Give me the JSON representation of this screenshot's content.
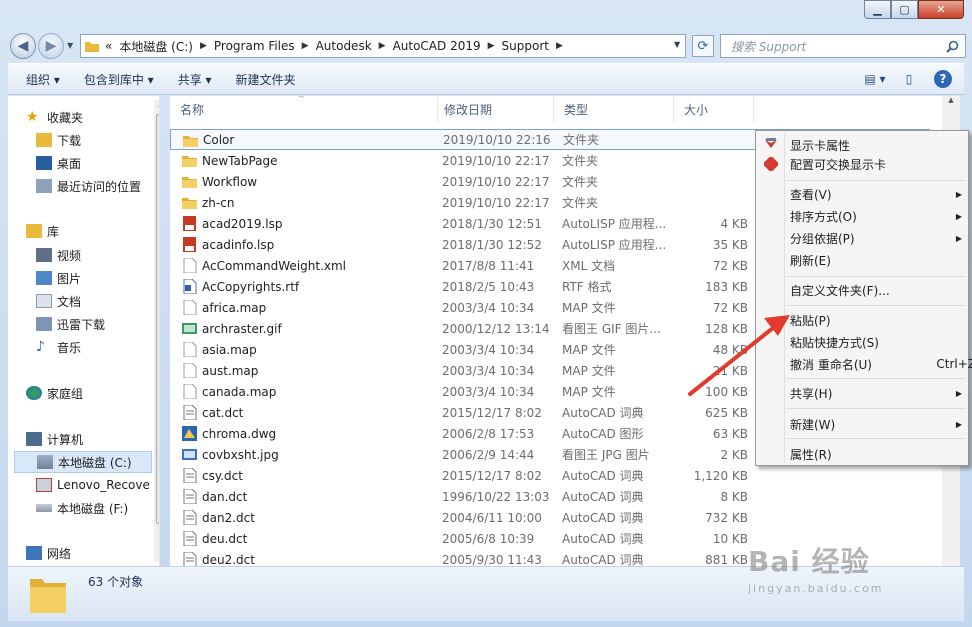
{
  "window": {
    "minimize": "▁",
    "maximize": "▢",
    "close": "✕"
  },
  "address": {
    "prefix": "«",
    "segments": [
      "本地磁盘 (C:)",
      "Program Files",
      "Autodesk",
      "AutoCAD 2019",
      "Support"
    ]
  },
  "search": {
    "placeholder": "搜索 Support"
  },
  "toolbar": {
    "organize": "组织 ▾",
    "include": "包含到库中 ▾",
    "share": "共享 ▾",
    "new_folder": "新建文件夹"
  },
  "nav": {
    "favorites": "收藏夹",
    "downloads": "下载",
    "desktop": "桌面",
    "recent": "最近访问的位置",
    "libraries": "库",
    "videos": "视频",
    "pictures": "图片",
    "documents": "文档",
    "thunder": "迅雷下载",
    "music": "音乐",
    "homegroup": "家庭组",
    "computer": "计算机",
    "drive_c": "本地磁盘 (C:)",
    "lenovo": "Lenovo_Recove",
    "drive_f": "本地磁盘 (F:)",
    "network": "网络"
  },
  "columns": {
    "name": "名称",
    "date": "修改日期",
    "type": "类型",
    "size": "大小"
  },
  "files": [
    {
      "name": "Color",
      "date": "2019/10/10 22:16",
      "type": "文件夹",
      "size": "",
      "icon": "folder"
    },
    {
      "name": "NewTabPage",
      "date": "2019/10/10 22:17",
      "type": "文件夹",
      "size": "",
      "icon": "folder"
    },
    {
      "name": "Workflow",
      "date": "2019/10/10 22:17",
      "type": "文件夹",
      "size": "",
      "icon": "folder"
    },
    {
      "name": "zh-cn",
      "date": "2019/10/10 22:17",
      "type": "文件夹",
      "size": "",
      "icon": "folder"
    },
    {
      "name": "acad2019.lsp",
      "date": "2018/1/30 12:51",
      "type": "AutoLISP 应用程...",
      "size": "4 KB",
      "icon": "lsp"
    },
    {
      "name": "acadinfo.lsp",
      "date": "2018/1/30 12:52",
      "type": "AutoLISP 应用程...",
      "size": "35 KB",
      "icon": "lsp"
    },
    {
      "name": "AcCommandWeight.xml",
      "date": "2017/8/8 11:41",
      "type": "XML 文档",
      "size": "72 KB",
      "icon": "doc"
    },
    {
      "name": "AcCopyrights.rtf",
      "date": "2018/2/5 10:43",
      "type": "RTF 格式",
      "size": "183 KB",
      "icon": "rtf"
    },
    {
      "name": "africa.map",
      "date": "2003/3/4 10:34",
      "type": "MAP 文件",
      "size": "72 KB",
      "icon": "doc"
    },
    {
      "name": "archraster.gif",
      "date": "2000/12/12 13:14",
      "type": "看图王 GIF 图片...",
      "size": "128 KB",
      "icon": "gif"
    },
    {
      "name": "asia.map",
      "date": "2003/3/4 10:34",
      "type": "MAP 文件",
      "size": "48 KB",
      "icon": "doc"
    },
    {
      "name": "aust.map",
      "date": "2003/3/4 10:34",
      "type": "MAP 文件",
      "size": "21 KB",
      "icon": "doc"
    },
    {
      "name": "canada.map",
      "date": "2003/3/4 10:34",
      "type": "MAP 文件",
      "size": "100 KB",
      "icon": "doc"
    },
    {
      "name": "cat.dct",
      "date": "2015/12/17 8:02",
      "type": "AutoCAD 词典",
      "size": "625 KB",
      "icon": "dct"
    },
    {
      "name": "chroma.dwg",
      "date": "2006/2/8 17:53",
      "type": "AutoCAD 图形",
      "size": "63 KB",
      "icon": "dwg"
    },
    {
      "name": "covbxsht.jpg",
      "date": "2006/2/9 14:44",
      "type": "看图王 JPG 图片",
      "size": "2 KB",
      "icon": "jpg"
    },
    {
      "name": "csy.dct",
      "date": "2015/12/17 8:02",
      "type": "AutoCAD 词典",
      "size": "1,120 KB",
      "icon": "dct"
    },
    {
      "name": "dan.dct",
      "date": "1996/10/22 13:03",
      "type": "AutoCAD 词典",
      "size": "8 KB",
      "icon": "dct"
    },
    {
      "name": "dan2.dct",
      "date": "2004/6/11 10:00",
      "type": "AutoCAD 词典",
      "size": "732 KB",
      "icon": "dct"
    },
    {
      "name": "deu.dct",
      "date": "2005/6/8 10:39",
      "type": "AutoCAD 词典",
      "size": "10 KB",
      "icon": "dct"
    },
    {
      "name": "deu2.dct",
      "date": "2005/9/30 11:43",
      "type": "AutoCAD 词典",
      "size": "881 KB",
      "icon": "dct"
    }
  ],
  "status": {
    "count": "63 个对象"
  },
  "context_menu": {
    "display_props": "显示卡属性",
    "switchable": "配置可交换显示卡",
    "view": "查看(V)",
    "sort": "排序方式(O)",
    "group": "分组依据(P)",
    "refresh": "刷新(E)",
    "customize": "自定义文件夹(F)...",
    "paste": "粘贴(P)",
    "paste_shortcut": "粘贴快捷方式(S)",
    "undo": "撤消 重命名(U)",
    "undo_shortcut": "Ctrl+Z",
    "share": "共享(H)",
    "new": "新建(W)",
    "properties": "属性(R)"
  },
  "watermark": {
    "brand": "Bai 经验",
    "url": "jingyan.baidu.com"
  }
}
